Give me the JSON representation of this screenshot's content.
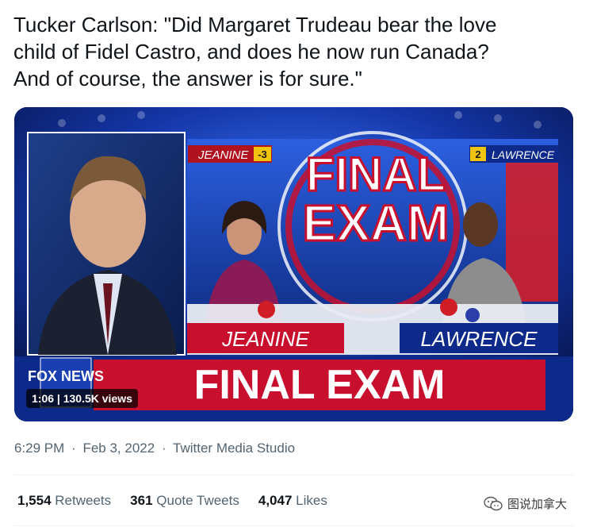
{
  "tweet": {
    "text": "Tucker Carlson: \"Did Margaret Trudeau bear the love\nchild of Fidel Castro, and does he now run Canada?\nAnd of course, the answer is for sure.\""
  },
  "video": {
    "duration": "1:06",
    "views": "130.5K views",
    "screen": {
      "network_logo": "FOX NEWS",
      "banner": "FINAL EXAM",
      "center_title_line1": "FINAL",
      "center_title_line2": "EXAM",
      "left_contestant": "JEANINE",
      "left_score": "-3",
      "right_contestant": "LAWRENCE",
      "right_score": "2",
      "brand_blue": "#1a3fb0",
      "brand_red": "#c8102e"
    }
  },
  "meta": {
    "time": "6:29 PM",
    "separator": "·",
    "date": "Feb 3, 2022",
    "source": "Twitter Media Studio"
  },
  "stats": {
    "retweets_count": "1,554",
    "retweets_label": "Retweets",
    "quotes_count": "361",
    "quotes_label": "Quote Tweets",
    "likes_count": "4,047",
    "likes_label": "Likes"
  },
  "watermark": {
    "text": "图说加拿大",
    "icon": "wechat-icon"
  }
}
